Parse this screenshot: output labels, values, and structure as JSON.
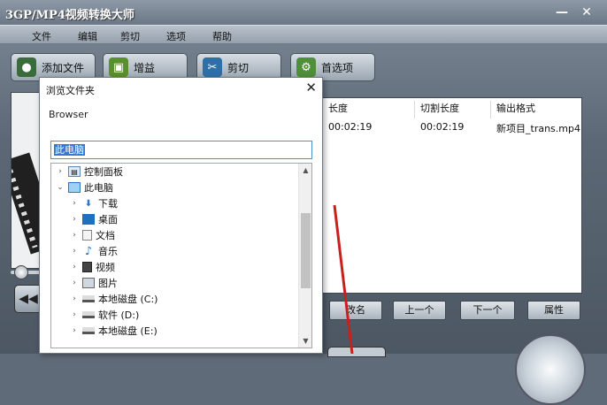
{
  "app": {
    "title": "3GP/MP4视频转换大师",
    "window_buttons": {
      "minimize": "—",
      "close": "✕"
    }
  },
  "menu": [
    {
      "label": "文件"
    },
    {
      "label": "编辑"
    },
    {
      "label": "剪切"
    },
    {
      "label": "选项"
    },
    {
      "label": "帮助"
    }
  ],
  "toolbar": {
    "add_file": "添加文件",
    "gain": "增益",
    "cut": "剪切",
    "preferences": "首选项"
  },
  "file_list": {
    "columns": [
      "长度",
      "切割长度",
      "输出格式"
    ],
    "rows": [
      {
        "length": "00:02:19",
        "cut_length": "00:02:19",
        "output": "新项目_trans.mp4"
      }
    ]
  },
  "actions": {
    "rename": "改名",
    "up": "上一个",
    "down": "下一个",
    "properties": "属性"
  },
  "dialog": {
    "title": "浏览文件夹",
    "close_glyph": "✕",
    "label": "Browser",
    "input_value": "此电脑",
    "tree": [
      {
        "label": "控制面板",
        "icon": "control-panel-icon",
        "chevron": "›"
      },
      {
        "label": "此电脑",
        "icon": "computer-icon",
        "chevron": "⌄"
      },
      {
        "label": "下载",
        "icon": "download-icon",
        "chevron": "›"
      },
      {
        "label": "桌面",
        "icon": "desktop-icon",
        "chevron": "›"
      },
      {
        "label": "文档",
        "icon": "document-icon",
        "chevron": "›"
      },
      {
        "label": "音乐",
        "icon": "music-icon",
        "chevron": "›"
      },
      {
        "label": "视频",
        "icon": "video-icon",
        "chevron": "›"
      },
      {
        "label": "图片",
        "icon": "picture-icon",
        "chevron": "›"
      },
      {
        "label": "本地磁盘 (C:)",
        "icon": "drive-icon",
        "chevron": "›"
      },
      {
        "label": "软件 (D:)",
        "icon": "drive-icon",
        "chevron": "›"
      },
      {
        "label": "本地磁盘 (E:)",
        "icon": "drive-icon",
        "chevron": "›"
      }
    ]
  },
  "colors": {
    "selection": "#3478d3",
    "arrow": "#c8201e"
  }
}
